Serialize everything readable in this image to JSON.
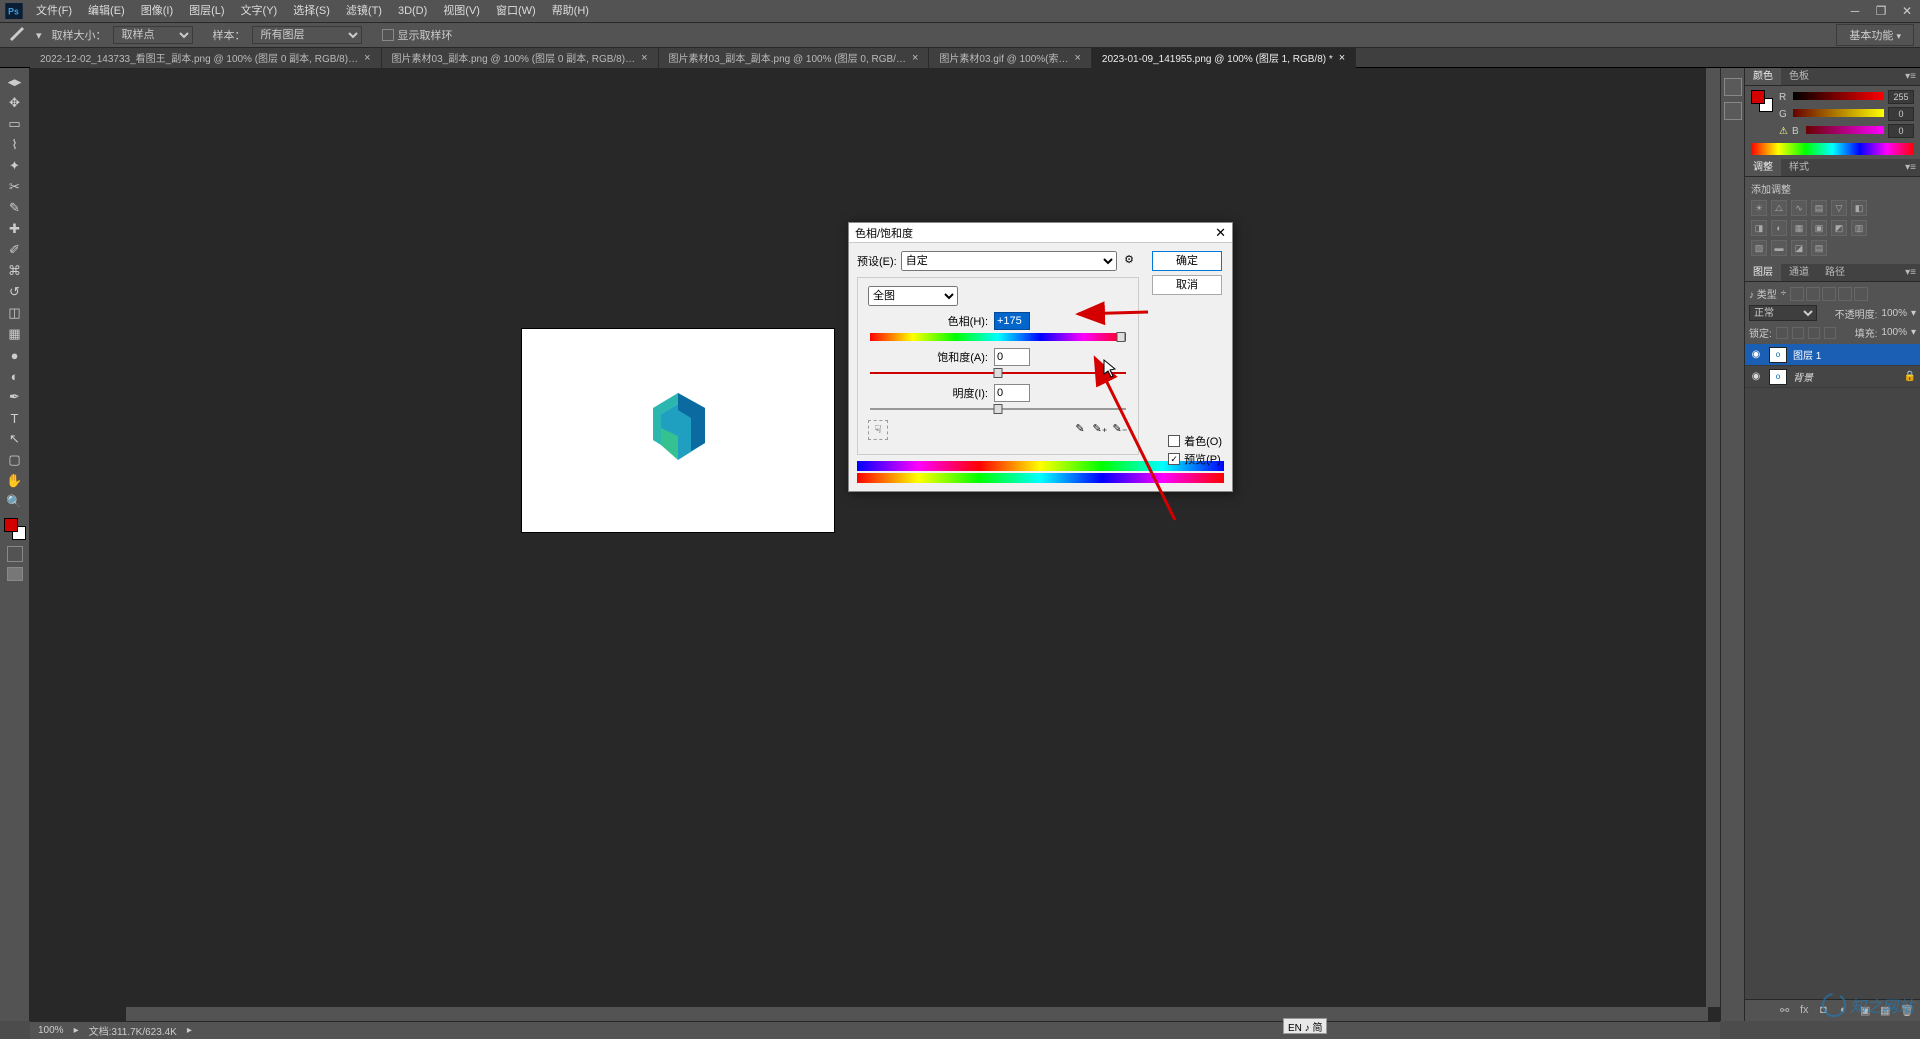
{
  "app": {
    "logo": "Ps"
  },
  "menu": {
    "items": [
      "文件(F)",
      "编辑(E)",
      "图像(I)",
      "图层(L)",
      "文字(Y)",
      "选择(S)",
      "滤镜(T)",
      "3D(D)",
      "视图(V)",
      "窗口(W)",
      "帮助(H)"
    ]
  },
  "options": {
    "sample_size_label": "取样大小：",
    "sample_size_value": "取样点",
    "sample_label": "样本：",
    "sample_value": "所有图层",
    "show_sample_ring": "显示取样环",
    "workspace": "基本功能"
  },
  "tabs": [
    {
      "label": "2022-12-02_143733_看图王_副本.png @ 100% (图层 0 副本, RGB/8)…",
      "active": false
    },
    {
      "label": "图片素材03_副本.png @ 100% (图层 0 副本, RGB/8)…",
      "active": false
    },
    {
      "label": "图片素材03_副本_副本.png @ 100% (图层 0, RGB/…",
      "active": false
    },
    {
      "label": "图片素材03.gif @ 100%(索…",
      "active": false
    },
    {
      "label": "2023-01-09_141955.png @ 100% (图层 1, RGB/8) *",
      "active": true
    }
  ],
  "toolbox": {
    "tools": [
      "move",
      "marquee",
      "lasso",
      "wand",
      "crop",
      "eyedrop",
      "heal",
      "brush",
      "stamp",
      "history",
      "eraser",
      "gradient",
      "blur",
      "dodge",
      "pen",
      "type",
      "path",
      "shape",
      "hand",
      "zoom"
    ]
  },
  "status": {
    "zoom": "100%",
    "doc_info": "文档:311.7K/623.4K"
  },
  "panels": {
    "color_tabs": {
      "color": "颜色",
      "swatches": "色板"
    },
    "color": {
      "r": "255",
      "g": "0",
      "b": "0",
      "r_label": "R",
      "g_label": "G",
      "b_label": "B"
    },
    "adjust_tabs": {
      "adjust": "调整",
      "styles": "样式"
    },
    "adjust_title": "添加调整",
    "layers_tabs": {
      "layers": "图层",
      "channels": "通道",
      "paths": "路径"
    },
    "layers": {
      "kind_label": "♪ 类型",
      "blend_mode": "正常",
      "opacity_label": "不透明度:",
      "opacity_value": "100%",
      "lock_label": "锁定:",
      "fill_label": "填充:",
      "fill_value": "100%",
      "rows": [
        {
          "name": "图层 1",
          "selected": true,
          "locked": false
        },
        {
          "name": "背景",
          "selected": false,
          "locked": true
        }
      ]
    }
  },
  "dialog": {
    "title": "色相/饱和度",
    "preset_label": "预设(E):",
    "preset_value": "自定",
    "ok": "确定",
    "cancel": "取消",
    "scope": "全图",
    "hue_label": "色相(H):",
    "hue_value": "+175",
    "sat_label": "饱和度(A):",
    "sat_value": "0",
    "light_label": "明度(I):",
    "light_value": "0",
    "colorize": "着色(O)",
    "preview": "预览(P)"
  },
  "ime": "EN ♪ 简",
  "watermark": "知之网站"
}
